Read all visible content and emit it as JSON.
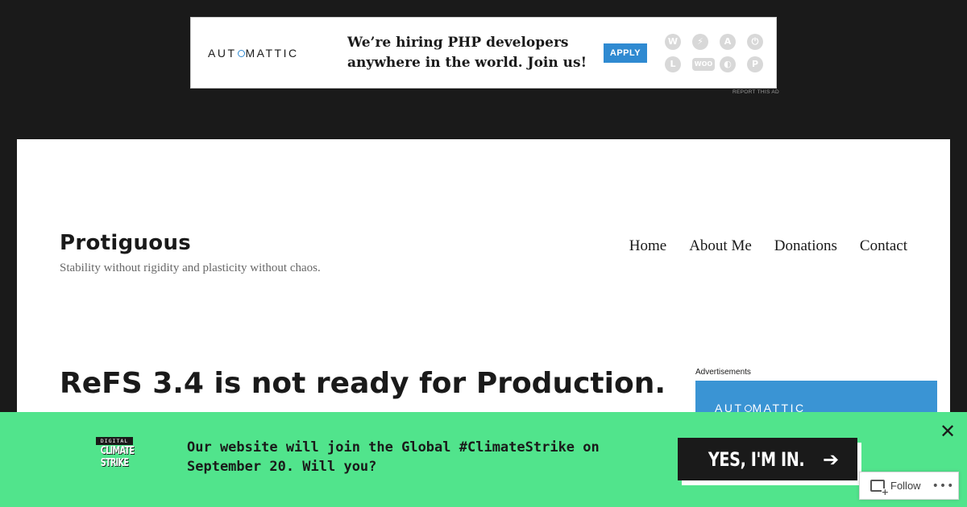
{
  "top_ad": {
    "brand_parts": [
      "AUT",
      "MATTIC"
    ],
    "headline_line1": "We’re hiring PHP developers",
    "headline_line2": "anywhere in the world. Join us!",
    "apply_label": "APPLY",
    "icons": [
      "wordpress-icon",
      "jetpack-icon",
      "akismet-icon",
      "power-icon",
      "longreads-icon",
      "woo-icon",
      "simplenote-icon",
      "polldaddy-icon"
    ],
    "icon_glyphs": [
      "W",
      "⚡",
      "A",
      "⏻",
      "L",
      "WOO",
      "◐",
      "P"
    ],
    "report_label": "REPORT THIS AD"
  },
  "site": {
    "title": "Protiguous",
    "tagline": "Stability without rigidity and plasticity without chaos."
  },
  "nav": {
    "items": [
      "Home",
      "About Me",
      "Donations",
      "Contact"
    ]
  },
  "post": {
    "title": "ReFS 3.4 is not ready for Production."
  },
  "sidebar": {
    "ads_label": "Advertisements",
    "ad_brand_parts": [
      "AUT",
      "MATTIC"
    ]
  },
  "climate_banner": {
    "logo_digital": "DIGITAL",
    "logo_word1": "CLIMATE",
    "logo_word2": "STRIKE",
    "message_line1": "Our website will join the Global #ClimateStrike on",
    "message_line2": "September 20. Will you?",
    "cta_label": "YES, I'M IN.",
    "cta_arrow": "➔",
    "close_glyph": "✕"
  },
  "follow_widget": {
    "label": "Follow",
    "more": "•••"
  },
  "colors": {
    "page_bg": "#1a1a1a",
    "banner_green": "#51e48c",
    "automattic_blue": "#2f8ad1"
  }
}
